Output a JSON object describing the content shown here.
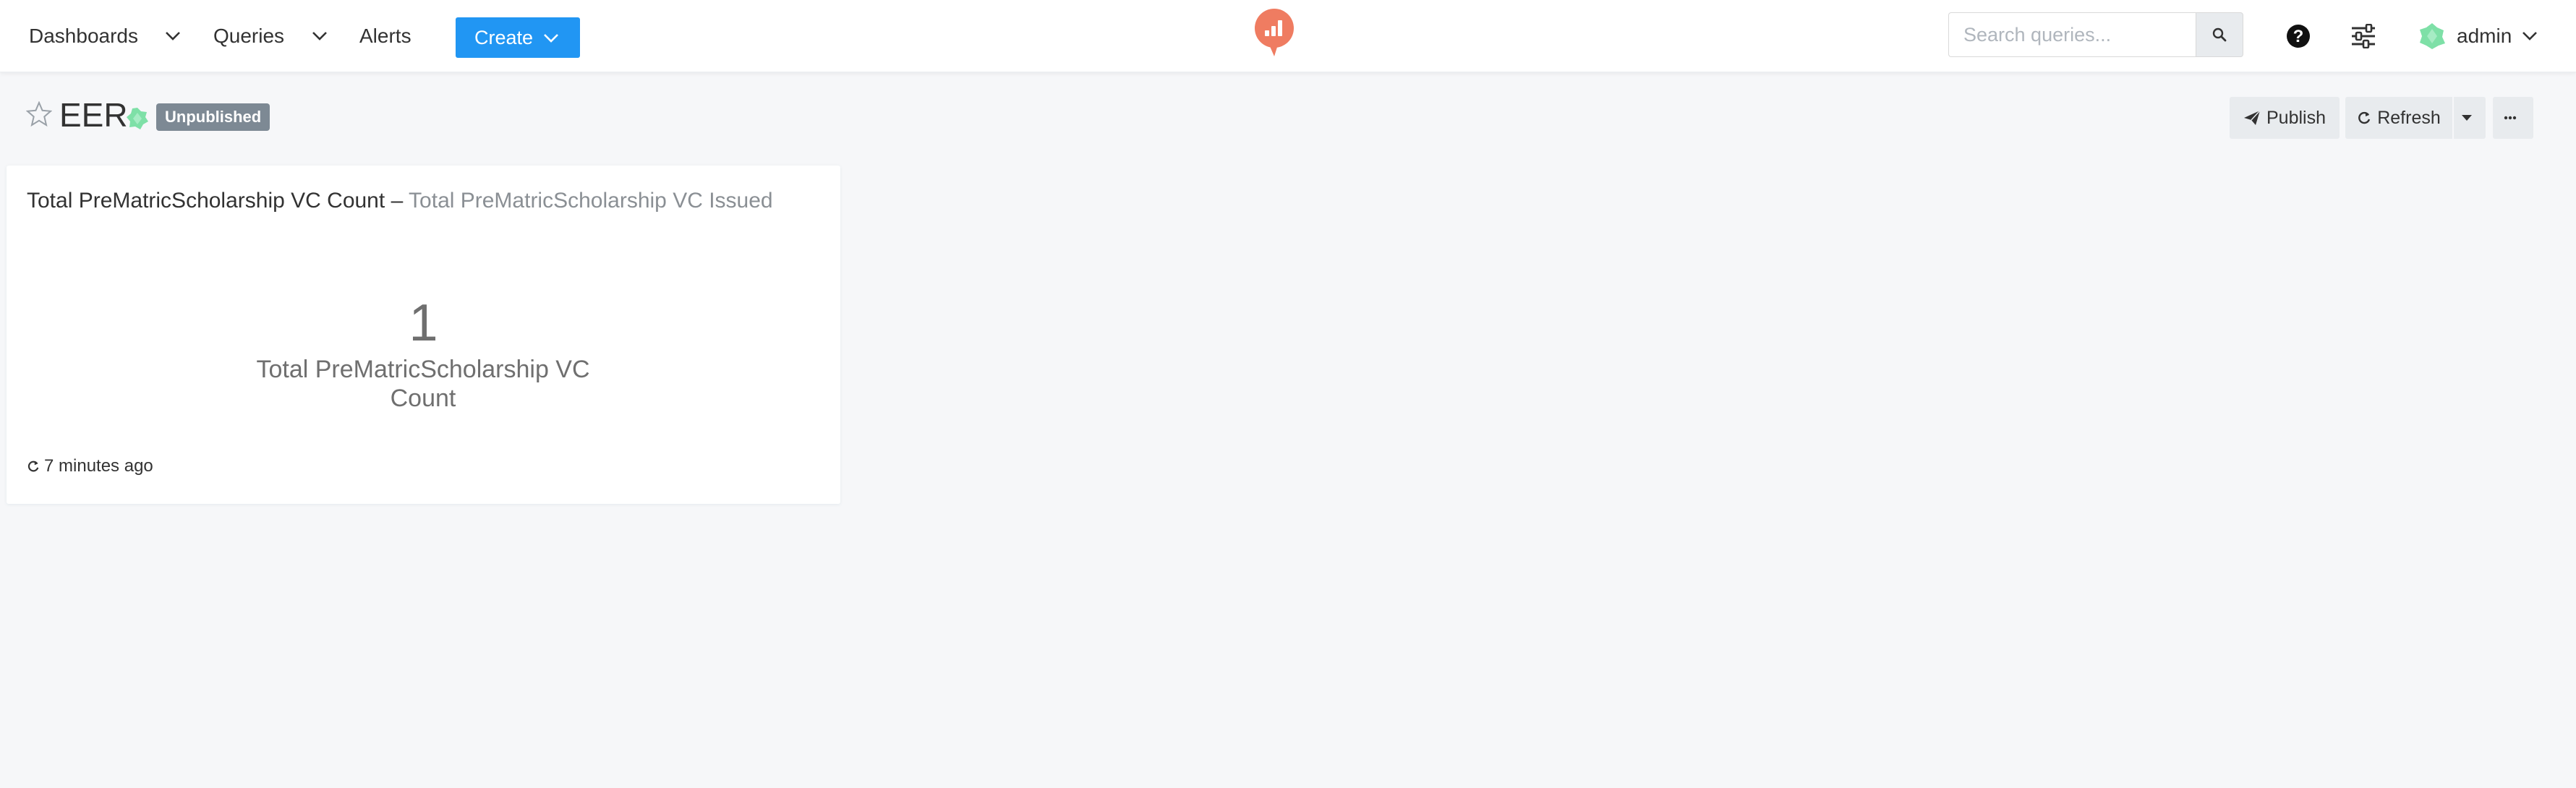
{
  "nav": {
    "dashboards": "Dashboards",
    "queries": "Queries",
    "alerts": "Alerts",
    "create": "Create",
    "search_placeholder": "Search queries...",
    "user": "admin"
  },
  "dashboard": {
    "title": "EER",
    "status_badge": "Unpublished",
    "favorite": false,
    "actions": {
      "publish": "Publish",
      "refresh": "Refresh"
    }
  },
  "widget": {
    "query_name": "Total PreMatricScholarship VC Count",
    "separator": "–",
    "description": "Total PreMatricScholarship VC Issued",
    "counter_value": "1",
    "counter_label": "Total PreMatricScholarship VC Count",
    "updated": "7 minutes ago"
  },
  "colors": {
    "primary": "#2196f3",
    "badge": "#7d8994",
    "logo": "#ef7c61",
    "avatar": "#7ee0a7"
  },
  "icons": [
    "chevron-down-icon",
    "logo-icon",
    "search-icon",
    "help-icon",
    "settings-sliders-icon",
    "avatar-icon",
    "star-icon",
    "tag-icon",
    "send-icon",
    "refresh-icon",
    "caret-down-icon",
    "ellipsis-icon"
  ]
}
